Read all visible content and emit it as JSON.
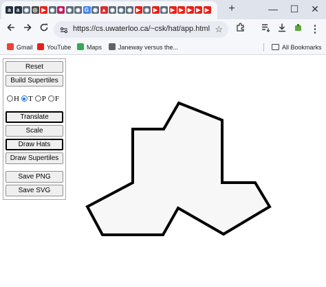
{
  "browser": {
    "tab_favicons": [
      {
        "name": "amazon-icon",
        "glyph": "a",
        "color": "#232f3e"
      },
      {
        "name": "amazon-icon",
        "glyph": "a",
        "color": "#232f3e"
      },
      {
        "name": "site-icon",
        "glyph": "◉",
        "color": "#5b6b7c"
      },
      {
        "name": "site-icon",
        "glyph": "◎",
        "color": "#4a4a4a"
      },
      {
        "name": "youtube-icon",
        "glyph": "▶",
        "color": "#e62117"
      },
      {
        "name": "site-icon",
        "glyph": "◉",
        "color": "#5b6b7c"
      },
      {
        "name": "star-icon",
        "glyph": "✸",
        "color": "#c2185b"
      },
      {
        "name": "site-icon",
        "glyph": "◉",
        "color": "#5b6b7c"
      },
      {
        "name": "site-icon",
        "glyph": "◉",
        "color": "#5b6b7c"
      },
      {
        "name": "google-icon",
        "glyph": "G",
        "color": "#4285f4"
      },
      {
        "name": "site-icon",
        "glyph": "◉",
        "color": "#5b6b7c"
      },
      {
        "name": "triangle-icon",
        "glyph": "▲",
        "color": "#d32f2f"
      },
      {
        "name": "site-icon",
        "glyph": "◉",
        "color": "#5b6b7c"
      },
      {
        "name": "site-icon",
        "glyph": "◉",
        "color": "#5b6b7c"
      },
      {
        "name": "site-icon",
        "glyph": "◉",
        "color": "#5b6b7c"
      },
      {
        "name": "youtube-icon",
        "glyph": "▶",
        "color": "#e62117"
      },
      {
        "name": "site-icon",
        "glyph": "◉",
        "color": "#5b6b7c"
      },
      {
        "name": "youtube-icon",
        "glyph": "▶",
        "color": "#e62117"
      },
      {
        "name": "site-icon",
        "glyph": "◉",
        "color": "#5b6b7c"
      },
      {
        "name": "youtube-icon",
        "glyph": "▶",
        "color": "#e62117"
      },
      {
        "name": "youtube-icon",
        "glyph": "▶",
        "color": "#e62117"
      },
      {
        "name": "youtube-icon",
        "glyph": "▶",
        "color": "#e62117"
      },
      {
        "name": "youtube-icon",
        "glyph": "▶",
        "color": "#e62117"
      },
      {
        "name": "youtube-icon",
        "glyph": "▶",
        "color": "#e62117"
      }
    ],
    "new_tab_glyph": "+",
    "window_controls": {
      "minimize": "—",
      "maximize": "☐",
      "close": "✕"
    },
    "url": "https://cs.uwaterloo.ca/~csk/hat/app.html",
    "bookmarks": [
      {
        "label": "Gmail",
        "icon": "gmail-icon",
        "color": "#ea4335"
      },
      {
        "label": "YouTube",
        "icon": "youtube-icon",
        "color": "#e62117"
      },
      {
        "label": "Maps",
        "icon": "maps-icon",
        "color": "#34a853"
      },
      {
        "label": "Janeway versus the...",
        "icon": "site-icon",
        "color": "#5f6368"
      }
    ],
    "all_bookmarks": "All Bookmarks"
  },
  "app": {
    "buttons_top": [
      "Reset",
      "Build Supertiles"
    ],
    "radios": [
      {
        "label": "H",
        "checked": false
      },
      {
        "label": "T",
        "checked": true
      },
      {
        "label": "P",
        "checked": false
      },
      {
        "label": "F",
        "checked": false
      }
    ],
    "buttons_mid": [
      {
        "label": "Translate",
        "active": true
      },
      {
        "label": "Scale",
        "active": false
      },
      {
        "label": "Draw Hats",
        "active": true
      },
      {
        "label": "Draw Supertiles",
        "active": false
      }
    ],
    "buttons_bottom": [
      "Save PNG",
      "Save SVG"
    ]
  }
}
